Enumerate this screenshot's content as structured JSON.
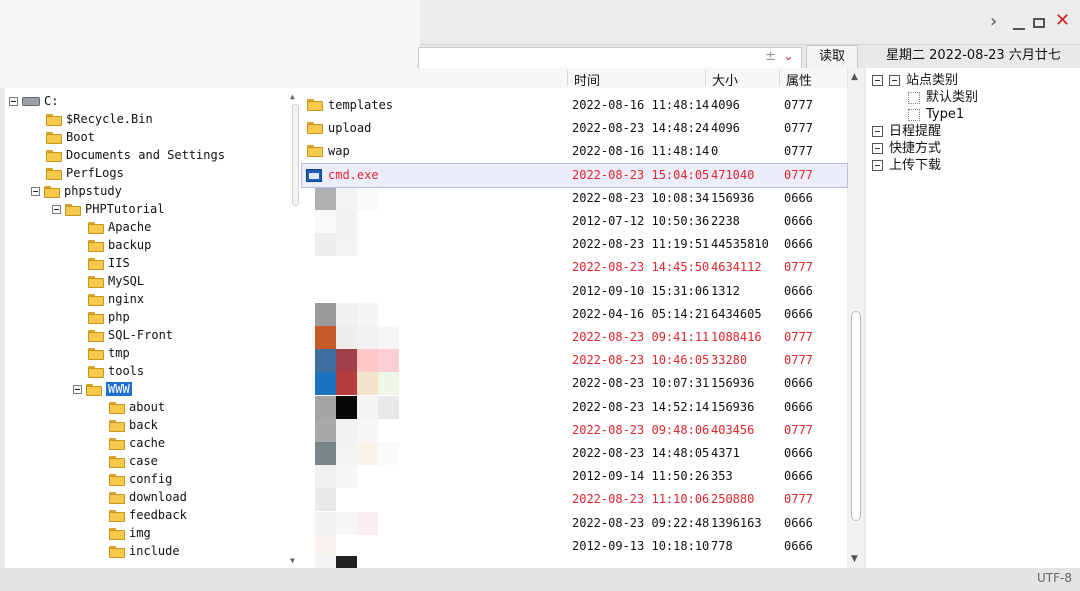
{
  "window": {
    "title": ""
  },
  "toolbar": {
    "path": "",
    "read_label": "读取",
    "date_label": "星期二  2022-08-23  六月廿七"
  },
  "list_columns": {
    "time": "时间",
    "size": "大小",
    "attr": "属性"
  },
  "tree": [
    {
      "label": "C:",
      "level": 0,
      "type": "drive",
      "expanded": true
    },
    {
      "label": "$Recycle.Bin",
      "level": 1,
      "type": "folder"
    },
    {
      "label": "Boot",
      "level": 1,
      "type": "folder"
    },
    {
      "label": "Documents and Settings",
      "level": 1,
      "type": "folder"
    },
    {
      "label": "PerfLogs",
      "level": 1,
      "type": "folder"
    },
    {
      "label": "phpstudy",
      "level": 1,
      "type": "folder",
      "expanded": true
    },
    {
      "label": "PHPTutorial",
      "level": 2,
      "type": "folder",
      "expanded": true
    },
    {
      "label": "Apache",
      "level": 3,
      "type": "folder"
    },
    {
      "label": "backup",
      "level": 3,
      "type": "folder"
    },
    {
      "label": "IIS",
      "level": 3,
      "type": "folder"
    },
    {
      "label": "MySQL",
      "level": 3,
      "type": "folder"
    },
    {
      "label": "nginx",
      "level": 3,
      "type": "folder"
    },
    {
      "label": "php",
      "level": 3,
      "type": "folder"
    },
    {
      "label": "SQL-Front",
      "level": 3,
      "type": "folder"
    },
    {
      "label": "tmp",
      "level": 3,
      "type": "folder"
    },
    {
      "label": "tools",
      "level": 3,
      "type": "folder"
    },
    {
      "label": "WWW",
      "level": 3,
      "type": "folder",
      "expanded": true,
      "selected": true
    },
    {
      "label": "about",
      "level": 4,
      "type": "folder"
    },
    {
      "label": "back",
      "level": 4,
      "type": "folder"
    },
    {
      "label": "cache",
      "level": 4,
      "type": "folder"
    },
    {
      "label": "case",
      "level": 4,
      "type": "folder"
    },
    {
      "label": "config",
      "level": 4,
      "type": "folder"
    },
    {
      "label": "download",
      "level": 4,
      "type": "folder"
    },
    {
      "label": "feedback",
      "level": 4,
      "type": "folder"
    },
    {
      "label": "img",
      "level": 4,
      "type": "folder"
    },
    {
      "label": "include",
      "level": 4,
      "type": "folder"
    }
  ],
  "files": [
    {
      "name": "templates",
      "time": "2022-08-16 11:48:14",
      "size": "4096",
      "attr": "0777",
      "icon": "folder"
    },
    {
      "name": "upload",
      "time": "2022-08-23 14:48:24",
      "size": "4096",
      "attr": "0777",
      "icon": "folder"
    },
    {
      "name": "wap",
      "time": "2022-08-16 11:48:14",
      "size": "0",
      "attr": "0777",
      "icon": "folder"
    },
    {
      "name": "cmd.exe",
      "time": "2022-08-23 15:04:05",
      "size": "471040",
      "attr": "0777",
      "icon": "exe",
      "highlight": true,
      "selected": true
    },
    {
      "name": "",
      "time": "2022-08-23 10:08:34",
      "size": "156936",
      "attr": "0666"
    },
    {
      "name": "",
      "time": "2012-07-12 10:50:36",
      "size": "2238",
      "attr": "0666"
    },
    {
      "name": "",
      "time": "2022-08-23 11:19:51",
      "size": "44535810",
      "attr": "0666"
    },
    {
      "name": "",
      "time": "2022-08-23 14:45:50",
      "size": "4634112",
      "attr": "0777",
      "highlight": true
    },
    {
      "name": "",
      "time": "2012-09-10 15:31:06",
      "size": "1312",
      "attr": "0666"
    },
    {
      "name": "",
      "time": "2022-04-16 05:14:21",
      "size": "6434605",
      "attr": "0666"
    },
    {
      "name": "",
      "time": "2022-08-23 09:41:11",
      "size": "1088416",
      "attr": "0777",
      "highlight": true
    },
    {
      "name": "",
      "time": "2022-08-23 10:46:05",
      "size": "33280",
      "attr": "0777",
      "highlight": true
    },
    {
      "name": "",
      "time": "2022-08-23 10:07:31",
      "size": "156936",
      "attr": "0666"
    },
    {
      "name": "",
      "time": "2022-08-23 14:52:14",
      "size": "156936",
      "attr": "0666"
    },
    {
      "name": "",
      "time": "2022-08-23 09:48:06",
      "size": "403456",
      "attr": "0777",
      "highlight": true
    },
    {
      "name": "",
      "time": "2022-08-23 14:48:05",
      "size": "4371",
      "attr": "0666"
    },
    {
      "name": "",
      "time": "2012-09-14 11:50:26",
      "size": "353",
      "attr": "0666"
    },
    {
      "name": "",
      "time": "2022-08-23 11:10:06",
      "size": "250880",
      "attr": "0777",
      "highlight": true
    },
    {
      "name": "",
      "time": "2022-08-23 09:22:48",
      "size": "1396163",
      "attr": "0666"
    },
    {
      "name": "",
      "time": "2012-09-13 10:18:10",
      "size": "778",
      "attr": "0666"
    }
  ],
  "categories": [
    {
      "label": "站点类别",
      "level": 0,
      "icon": "expander"
    },
    {
      "label": "默认类别",
      "level": 1,
      "icon": "sub"
    },
    {
      "label": "Type1",
      "level": 1,
      "icon": "sub"
    },
    {
      "label": "日程提醒",
      "level": 0,
      "icon": "schedule-icon"
    },
    {
      "label": "快捷方式",
      "level": 0,
      "icon": "shortcut-icon"
    },
    {
      "label": "上传下载",
      "level": 0,
      "icon": "transfer-icon"
    }
  ],
  "status": {
    "encoding": "UTF-8"
  },
  "colors": {
    "highlight_text": "#e0262c",
    "selection": "#1f6fd1"
  }
}
